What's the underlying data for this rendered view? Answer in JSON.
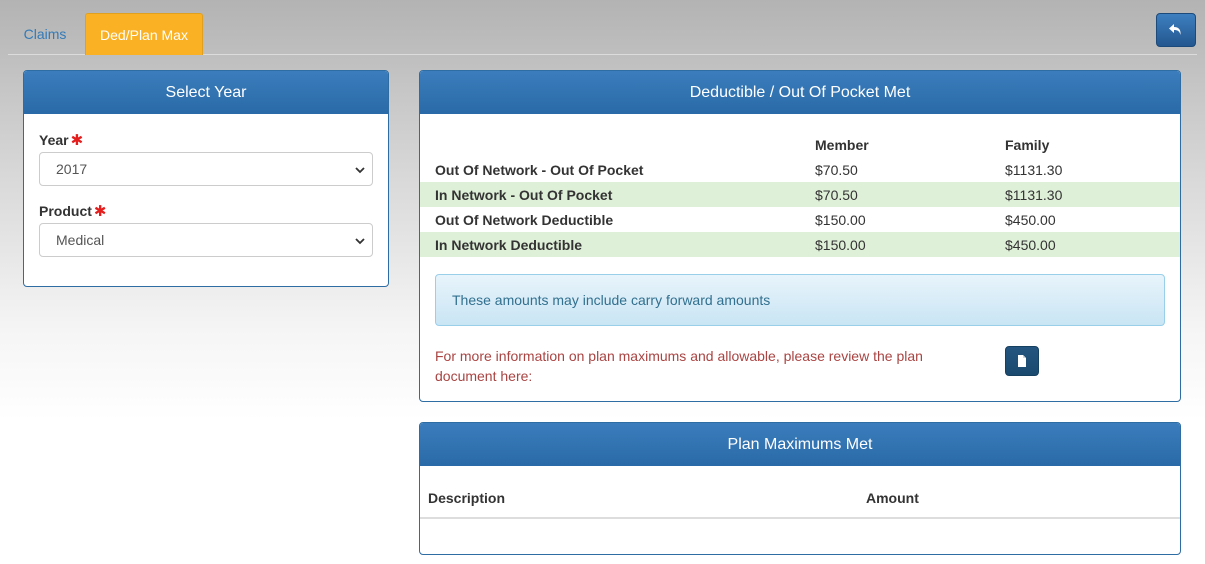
{
  "tabs": [
    {
      "label": "Claims",
      "active": false
    },
    {
      "label": "Ded/Plan Max",
      "active": true
    }
  ],
  "colors": {
    "accent_tab": "#fbb124",
    "panel_header": "#2f70af",
    "required": "#e41d1d",
    "highlight_row": "#dff0d8",
    "info_text": "#a94442"
  },
  "select_year": {
    "title": "Select Year",
    "year_label": "Year",
    "year_value": "2017",
    "product_label": "Product",
    "product_value": "Medical",
    "required_mark": "✱"
  },
  "deductible": {
    "title": "Deductible / Out Of Pocket Met",
    "columns": [
      "Member",
      "Family"
    ],
    "rows": [
      {
        "label": "Out Of Network - Out Of Pocket",
        "member": "$70.50",
        "family": "$1131.30",
        "highlighted": false
      },
      {
        "label": "In Network - Out Of Pocket",
        "member": "$70.50",
        "family": "$1131.30",
        "highlighted": true
      },
      {
        "label": "Out Of Network Deductible",
        "member": "$150.00",
        "family": "$450.00",
        "highlighted": false
      },
      {
        "label": "In Network Deductible",
        "member": "$150.00",
        "family": "$450.00",
        "highlighted": true
      }
    ],
    "alert": "These amounts may include carry forward amounts",
    "info": "For more information on plan maximums and allowable, please review the plan document here:"
  },
  "plan_max": {
    "title": "Plan Maximums Met",
    "columns": [
      "Description",
      "Amount"
    ]
  },
  "icons": {
    "back": "undo-arrow-icon",
    "document": "file-icon",
    "dropdown": "chevron-down-icon"
  }
}
